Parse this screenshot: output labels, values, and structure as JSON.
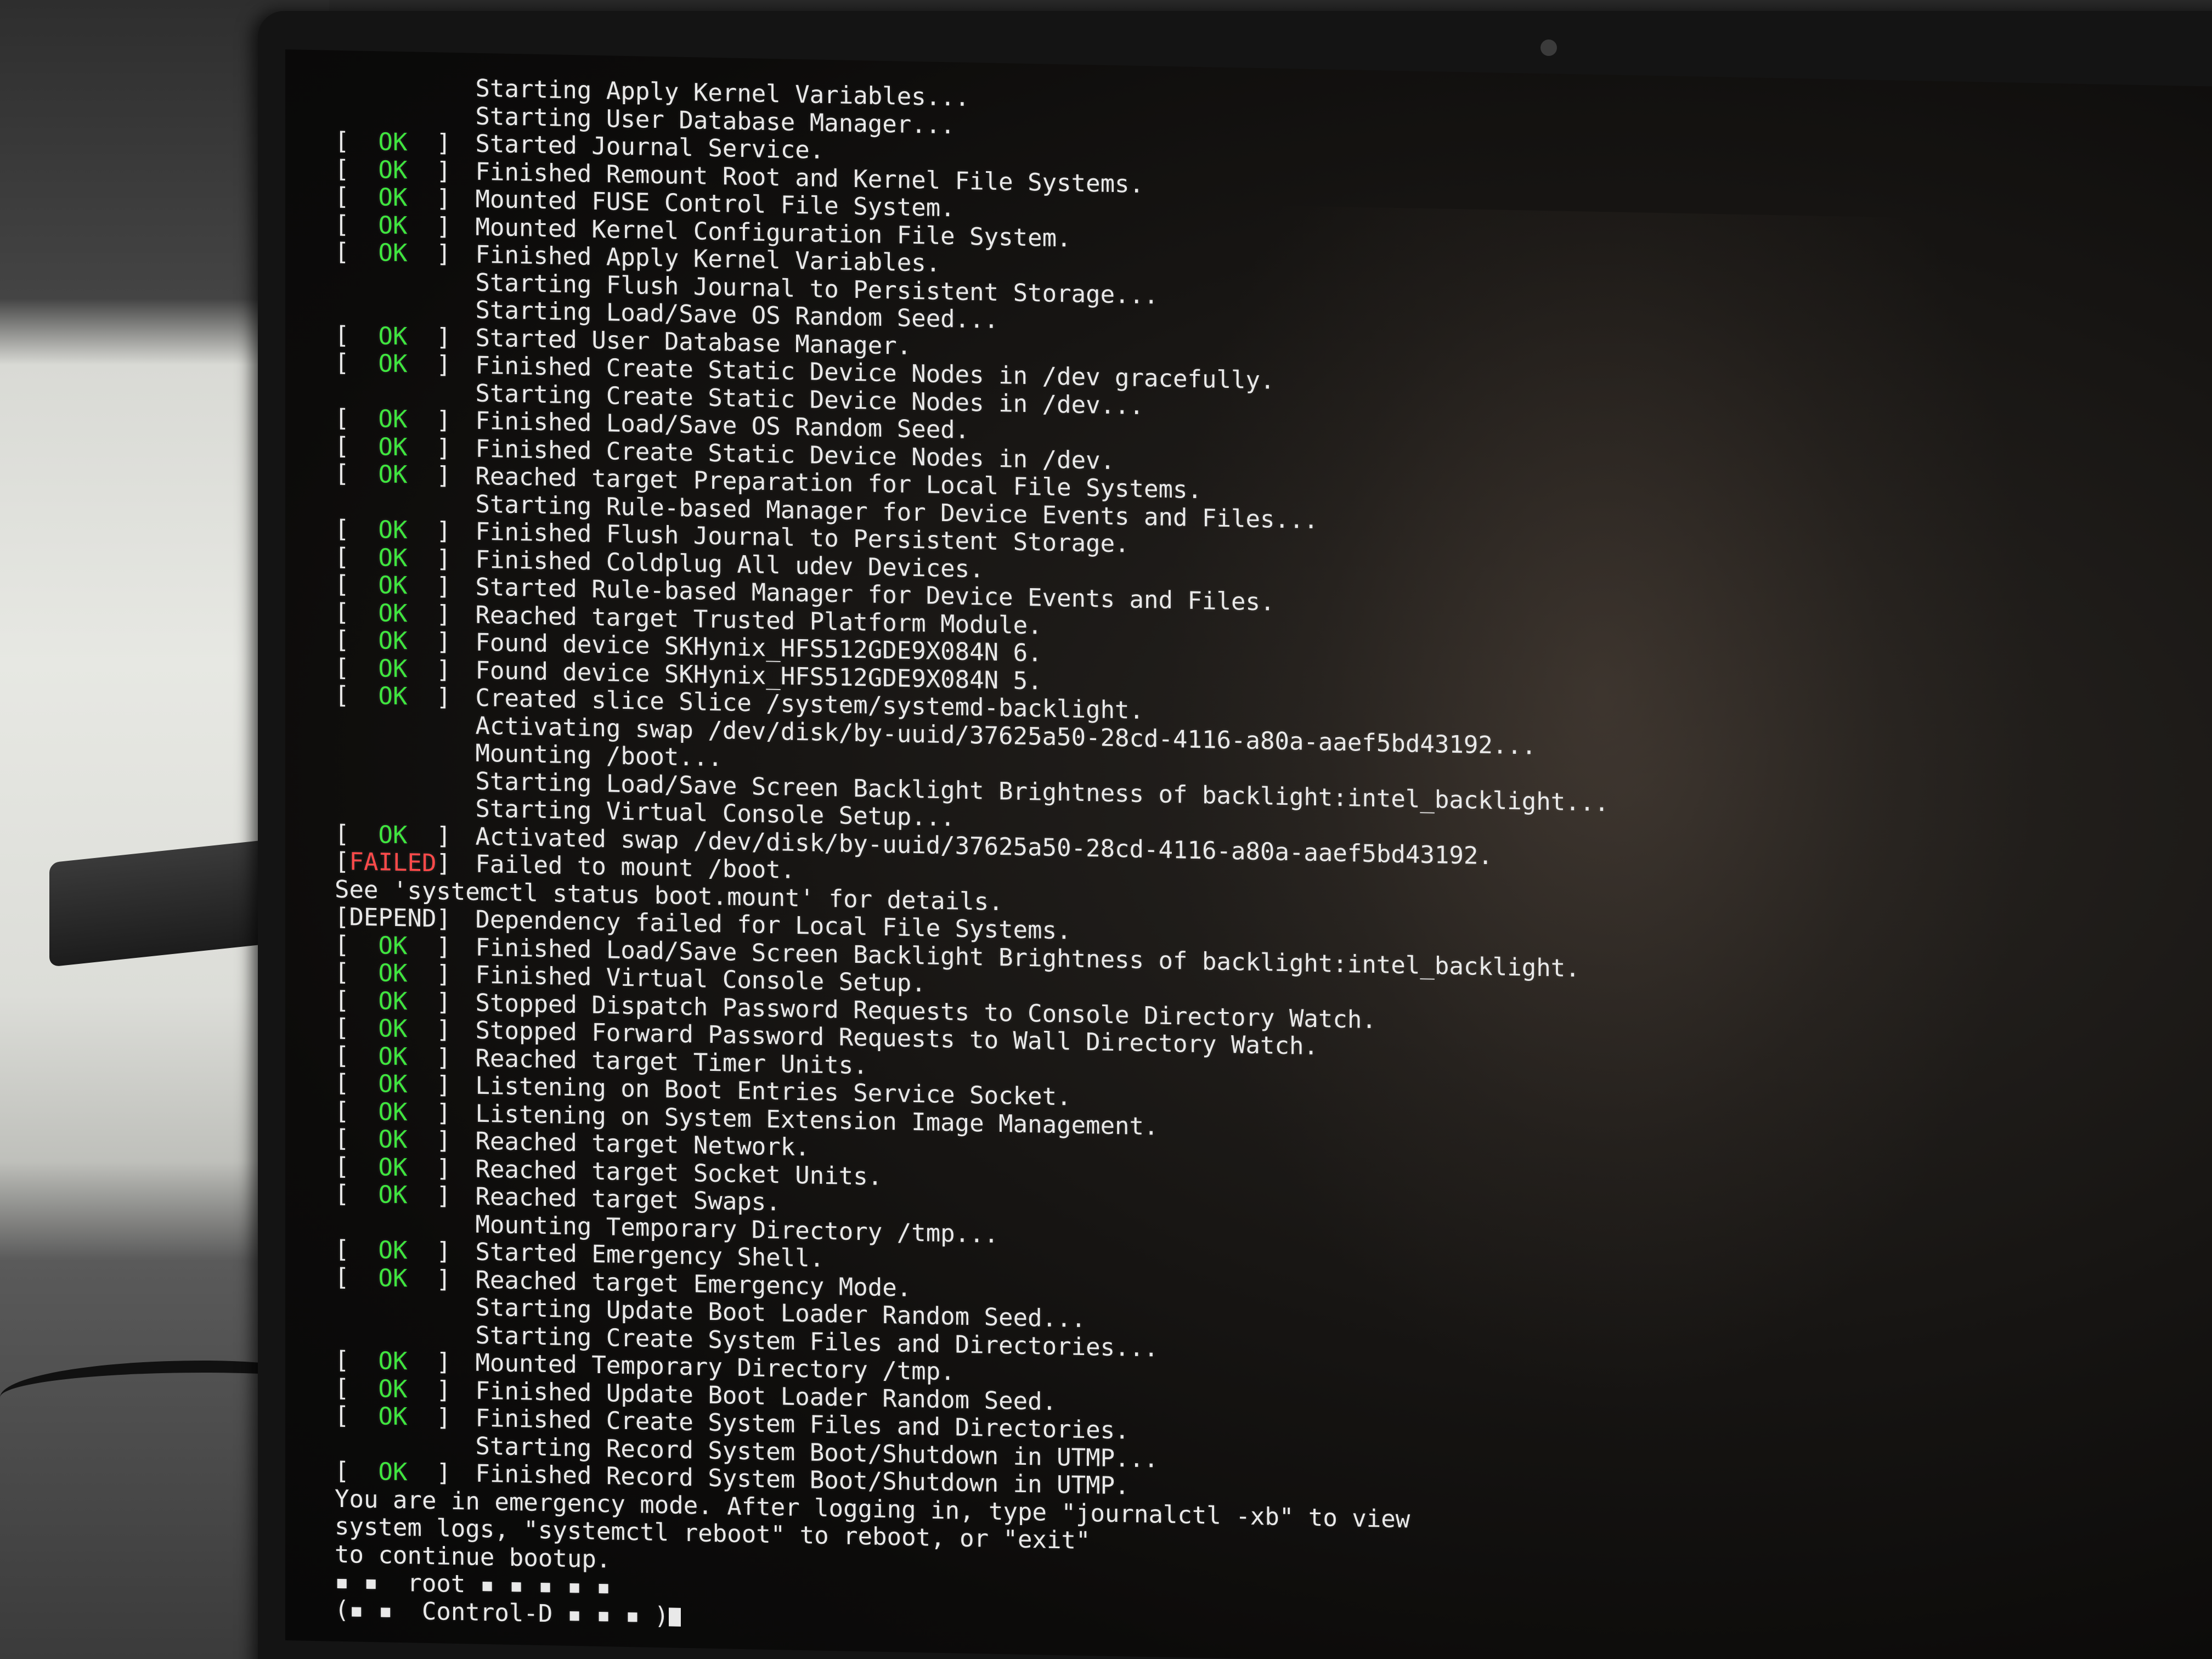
{
  "boot_log": [
    {
      "status": "",
      "text": "Starting Apply Kernel Variables..."
    },
    {
      "status": "",
      "text": "Starting User Database Manager..."
    },
    {
      "status": "OK",
      "text": "Started Journal Service."
    },
    {
      "status": "OK",
      "text": "Finished Remount Root and Kernel File Systems."
    },
    {
      "status": "OK",
      "text": "Mounted FUSE Control File System."
    },
    {
      "status": "OK",
      "text": "Mounted Kernel Configuration File System."
    },
    {
      "status": "OK",
      "text": "Finished Apply Kernel Variables."
    },
    {
      "status": "",
      "text": "Starting Flush Journal to Persistent Storage..."
    },
    {
      "status": "",
      "text": "Starting Load/Save OS Random Seed..."
    },
    {
      "status": "OK",
      "text": "Started User Database Manager."
    },
    {
      "status": "OK",
      "text": "Finished Create Static Device Nodes in /dev gracefully."
    },
    {
      "status": "",
      "text": "Starting Create Static Device Nodes in /dev..."
    },
    {
      "status": "OK",
      "text": "Finished Load/Save OS Random Seed."
    },
    {
      "status": "OK",
      "text": "Finished Create Static Device Nodes in /dev."
    },
    {
      "status": "OK",
      "text": "Reached target Preparation for Local File Systems."
    },
    {
      "status": "",
      "text": "Starting Rule-based Manager for Device Events and Files..."
    },
    {
      "status": "OK",
      "text": "Finished Flush Journal to Persistent Storage."
    },
    {
      "status": "OK",
      "text": "Finished Coldplug All udev Devices."
    },
    {
      "status": "OK",
      "text": "Started Rule-based Manager for Device Events and Files."
    },
    {
      "status": "OK",
      "text": "Reached target Trusted Platform Module."
    },
    {
      "status": "OK",
      "text": "Found device SKHynix_HFS512GDE9X084N 6."
    },
    {
      "status": "OK",
      "text": "Found device SKHynix_HFS512GDE9X084N 5."
    },
    {
      "status": "OK",
      "text": "Created slice Slice /system/systemd-backlight."
    },
    {
      "status": "",
      "text": "Activating swap /dev/disk/by-uuid/37625a50-28cd-4116-a80a-aaef5bd43192..."
    },
    {
      "status": "",
      "text": "Mounting /boot..."
    },
    {
      "status": "",
      "text": "Starting Load/Save Screen Backlight Brightness of backlight:intel_backlight..."
    },
    {
      "status": "",
      "text": "Starting Virtual Console Setup..."
    },
    {
      "status": "OK",
      "text": "Activated swap /dev/disk/by-uuid/37625a50-28cd-4116-a80a-aaef5bd43192."
    },
    {
      "status": "FAILED",
      "text": "Failed to mount /boot."
    },
    {
      "status": "SEE",
      "text": "See 'systemctl status boot.mount' for details."
    },
    {
      "status": "DEPEND",
      "text": "Dependency failed for Local File Systems."
    },
    {
      "status": "OK",
      "text": "Finished Load/Save Screen Backlight Brightness of backlight:intel_backlight."
    },
    {
      "status": "OK",
      "text": "Finished Virtual Console Setup."
    },
    {
      "status": "OK",
      "text": "Stopped Dispatch Password Requests to Console Directory Watch."
    },
    {
      "status": "OK",
      "text": "Stopped Forward Password Requests to Wall Directory Watch."
    },
    {
      "status": "OK",
      "text": "Reached target Timer Units."
    },
    {
      "status": "OK",
      "text": "Listening on Boot Entries Service Socket."
    },
    {
      "status": "OK",
      "text": "Listening on System Extension Image Management."
    },
    {
      "status": "OK",
      "text": "Reached target Network."
    },
    {
      "status": "OK",
      "text": "Reached target Socket Units."
    },
    {
      "status": "OK",
      "text": "Reached target Swaps."
    },
    {
      "status": "",
      "text": "Mounting Temporary Directory /tmp..."
    },
    {
      "status": "OK",
      "text": "Started Emergency Shell."
    },
    {
      "status": "OK",
      "text": "Reached target Emergency Mode."
    },
    {
      "status": "",
      "text": "Starting Update Boot Loader Random Seed..."
    },
    {
      "status": "",
      "text": "Starting Create System Files and Directories..."
    },
    {
      "status": "OK",
      "text": "Mounted Temporary Directory /tmp."
    },
    {
      "status": "OK",
      "text": "Finished Update Boot Loader Random Seed."
    },
    {
      "status": "OK",
      "text": "Finished Create System Files and Directories."
    },
    {
      "status": "",
      "text": "Starting Record System Boot/Shutdown in UTMP..."
    },
    {
      "status": "OK",
      "text": "Finished Record System Boot/Shutdown in UTMP."
    }
  ],
  "labels": {
    "ok": " OK ",
    "failed": "FAILED",
    "depend": "DEPEND"
  },
  "emergency": {
    "line1": "You are in emergency mode. After logging in, type \"journalctl -xb\" to view",
    "line2": "system logs, \"systemctl reboot\" to reboot, or \"exit\"",
    "line3": "to continue bootup.",
    "prompt_line": "▪ ▪  root ▪ ▪ ▪ ▪ ▪",
    "control_line": "(▪ ▪  Control-D ▪ ▪ ▪ )"
  },
  "colors": {
    "ok": "#3fe53f",
    "failed": "#ff4a4a",
    "text": "#e9e9e9"
  }
}
